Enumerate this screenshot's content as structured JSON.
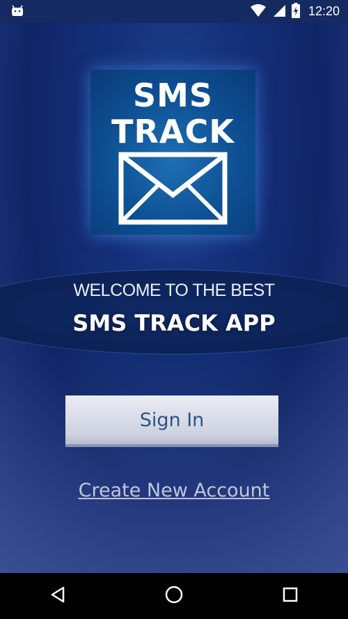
{
  "status_bar": {
    "time": "12:20",
    "icons": [
      "android-icon",
      "wifi-icon",
      "signal-icon",
      "battery-charging-icon"
    ]
  },
  "logo": {
    "line1": "SMS",
    "line2": "TRACK",
    "icon": "envelope-icon"
  },
  "welcome": {
    "subtitle": "WELCOME TO THE BEST",
    "title": "SMS TRACK APP"
  },
  "actions": {
    "sign_in_label": "Sign In",
    "create_account_label": "Create New Account"
  },
  "nav_bar": {
    "icons": [
      "back-icon",
      "home-icon",
      "recents-icon"
    ]
  },
  "colors": {
    "status_bar": "#142a60",
    "background": "#15307a",
    "logo_tile": "#0d4f92",
    "button_text": "#27507f",
    "nav_bar": "#000000"
  }
}
